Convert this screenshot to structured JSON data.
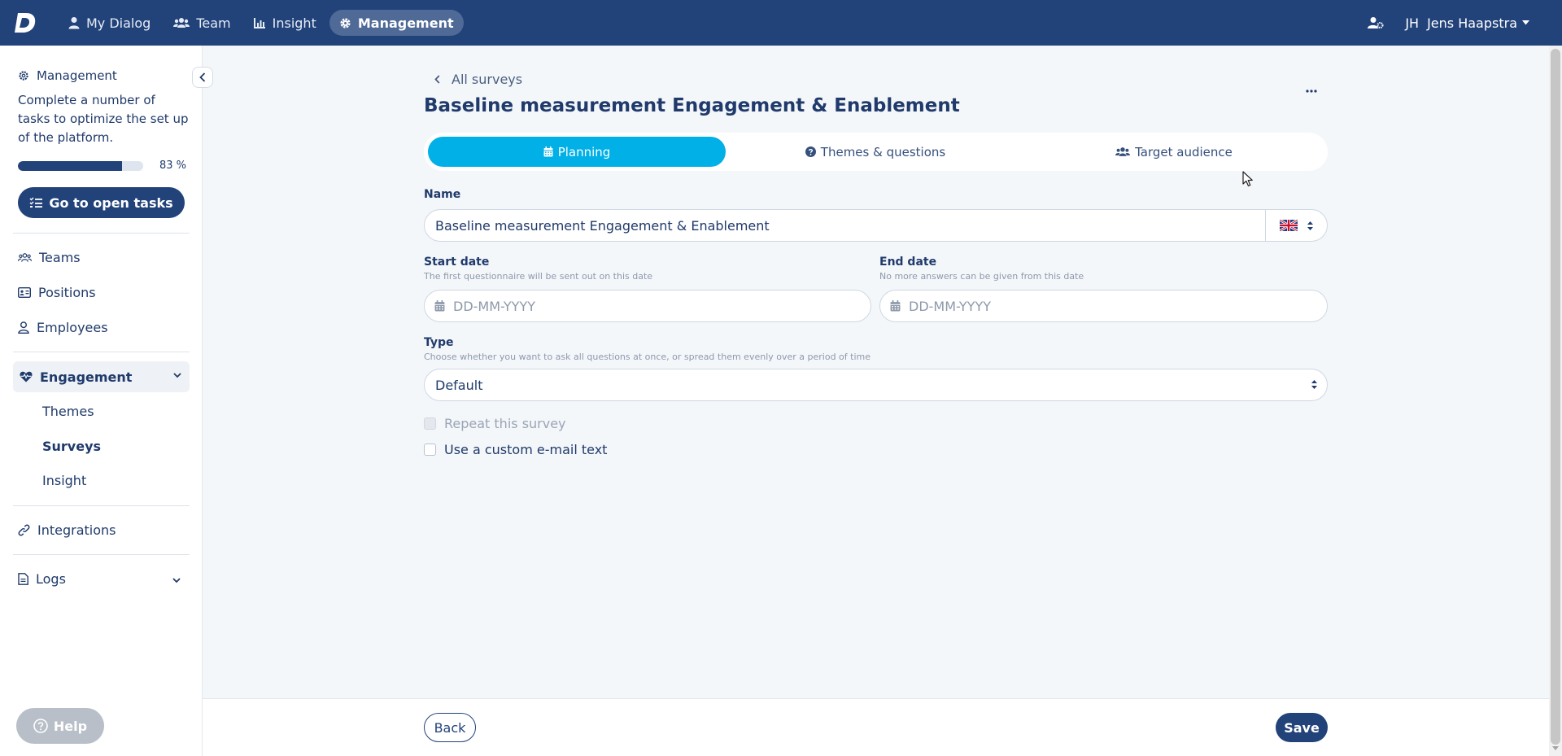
{
  "topnav": {
    "items": [
      {
        "label": "My Dialog",
        "icon": "user-icon"
      },
      {
        "label": "Team",
        "icon": "users-icon"
      },
      {
        "label": "Insight",
        "icon": "chart-icon"
      },
      {
        "label": "Management",
        "icon": "gear-icon",
        "active": true
      }
    ],
    "initials": "JH",
    "user_name": "Jens Haapstra"
  },
  "sidebar": {
    "management_title": "Management",
    "management_description": "Complete a number of tasks to optimize the set up of the platform.",
    "progress_percent": 83,
    "progress_label": "83 %",
    "open_tasks_label": "Go to open tasks",
    "items": [
      {
        "label": "Teams",
        "icon": "users-icon"
      },
      {
        "label": "Positions",
        "icon": "id-card-icon"
      },
      {
        "label": "Employees",
        "icon": "user-icon"
      }
    ],
    "engagement": {
      "label": "Engagement",
      "icon": "heartbeat-icon",
      "expanded": true,
      "sub_items": [
        {
          "label": "Themes"
        },
        {
          "label": "Surveys",
          "active": true
        },
        {
          "label": "Insight"
        }
      ]
    },
    "integrations_label": "Integrations",
    "logs_label": "Logs",
    "help_label": "Help"
  },
  "page": {
    "breadcrumb": "All surveys",
    "title": "Baseline measurement Engagement & Enablement",
    "tabs": [
      {
        "label": "Planning",
        "icon": "calendar-icon",
        "active": true
      },
      {
        "label": "Themes & questions",
        "icon": "question-circle-icon"
      },
      {
        "label": "Target audience",
        "icon": "users-icon"
      }
    ],
    "form": {
      "name_label": "Name",
      "name_value": "Baseline measurement Engagement & Enablement",
      "language": "en-GB",
      "start_date_label": "Start date",
      "start_date_hint": "The first questionnaire will be sent out on this date",
      "start_date_placeholder": "DD-MM-YYYY",
      "end_date_label": "End date",
      "end_date_hint": "No more answers can be given from this date",
      "end_date_placeholder": "DD-MM-YYYY",
      "type_label": "Type",
      "type_hint": "Choose whether you want to ask all questions at once, or spread them evenly over a period of time",
      "type_value": "Default",
      "repeat_label": "Repeat this survey",
      "custom_email_label": "Use a custom e-mail text"
    },
    "footer": {
      "back_label": "Back",
      "save_label": "Save"
    }
  },
  "colors": {
    "nav_bg": "#22427a",
    "accent": "#00b0e6",
    "text": "#1f3a6b"
  }
}
